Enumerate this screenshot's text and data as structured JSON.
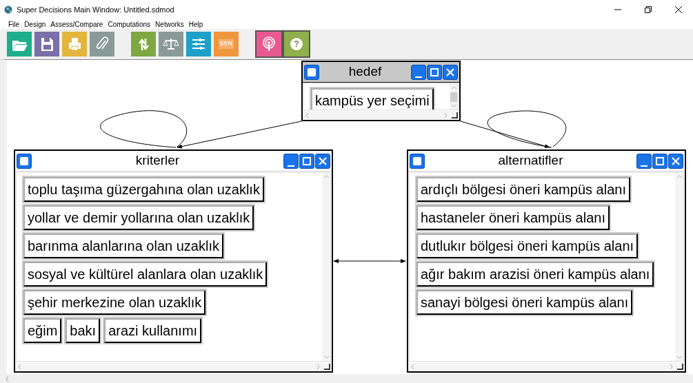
{
  "window": {
    "title": "Super Decisions Main Window: Untitled.sdmod"
  },
  "menu": [
    "File",
    "Design",
    "Assess/Compare",
    "Computations",
    "Networks",
    "Help"
  ],
  "toolbar": [
    [
      {
        "kind": "open",
        "color": "#1fae8c"
      },
      {
        "kind": "save",
        "color": "#7a6fa8"
      },
      {
        "kind": "print",
        "color": "#e3b53c"
      },
      {
        "kind": "attach",
        "color": "#8a9a98"
      }
    ],
    [
      {
        "kind": "refresh",
        "color": "#7fa843"
      },
      {
        "kind": "scales",
        "color": "#8a9a98"
      },
      {
        "kind": "sliders",
        "color": "#1ea0c8"
      },
      {
        "kind": "text",
        "color": "#f0963c",
        "label": "SYN"
      }
    ],
    [
      {
        "kind": "signal",
        "color": "#e85a8f"
      },
      {
        "kind": "help",
        "color": "#8fb04a",
        "label": "?"
      }
    ]
  ],
  "clusters": [
    {
      "title": "hedef",
      "selected": true,
      "rows": [
        [
          "kampüs yer seçimi"
        ]
      ]
    },
    {
      "title": "kriterler",
      "selected": false,
      "rows": [
        [
          "toplu taşıma güzergahına olan uzaklık"
        ],
        [
          "yollar ve demir yollarına olan uzaklık"
        ],
        [
          "barınma alanlarına olan uzaklık"
        ],
        [
          "sosyal ve kültürel alanlara olan uzaklık"
        ],
        [
          "şehir merkezine olan uzaklık"
        ],
        [
          "eğim",
          "bakı",
          "arazi kullanımı"
        ]
      ]
    },
    {
      "title": "alternatifler",
      "selected": false,
      "rows": [
        [
          "ardıçlı bölgesi öneri kampüs alanı"
        ],
        [
          "hastaneler öneri kampüs alanı"
        ],
        [
          "dutlukır bölgesi öneri kampüs alanı"
        ],
        [
          "ağır bakım arazisi öneri kampüs alanı"
        ],
        [
          "sanayi bölgesi öneri kampüs alanı"
        ]
      ]
    }
  ]
}
